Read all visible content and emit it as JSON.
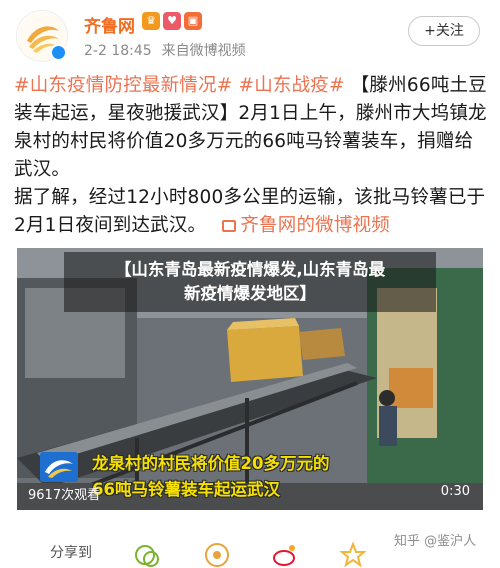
{
  "header": {
    "username": "齐鲁网",
    "meta_time": "2-2 18:45",
    "meta_source": "来自微博视频",
    "follow_label": "+关注"
  },
  "post": {
    "hashtag1": "#山东疫情防控最新情况#",
    "hashtag2": "#山东战疫#",
    "body1": " 【滕州66吨土豆装车起运，星夜驰援武汉】2月1日上午，滕州市大坞镇龙泉村的村民将价值20多万元的66吨马铃薯装车，捐赠给武汉。",
    "body2": "据了解，经过12小时800多公里的运输，该批马铃薯已于2月1日夜间到达武汉。",
    "video_link": "齐鲁网的微博视频"
  },
  "video": {
    "title_line1": "【山东青岛最新疫情爆发,山东青岛最",
    "title_line2": "新疫情爆发地区】",
    "caption_line1": "龙泉村的村民将价值20多万元的",
    "caption_line2": "66吨马铃薯装车起运武汉",
    "views": "9617次观看",
    "duration": "0:30"
  },
  "footer": {
    "share_label": "分享到",
    "watermark": "知乎 @鉴沪人"
  },
  "colors": {
    "brand_orange": "#f26d22",
    "link": "#eb7350",
    "caption_yellow": "#f5e000"
  }
}
